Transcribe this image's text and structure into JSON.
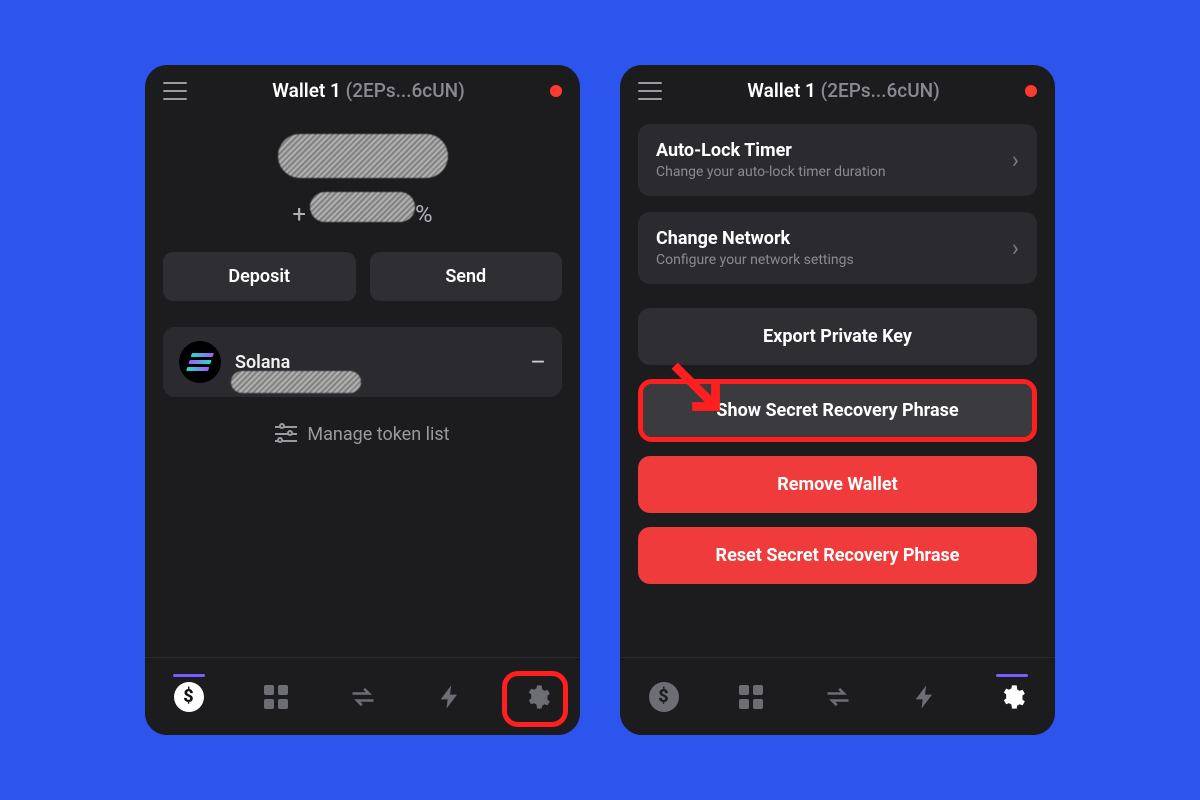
{
  "header": {
    "wallet_name": "Wallet 1",
    "short_address": "(2EPs...6cUN)"
  },
  "left": {
    "balance_hidden": true,
    "pct_prefix": "+",
    "pct_suffix": "%",
    "deposit_label": "Deposit",
    "send_label": "Send",
    "token": {
      "name": "Solana",
      "amount_indicator": "–"
    },
    "manage_label": "Manage token list"
  },
  "right": {
    "rows": [
      {
        "title": "Auto-Lock Timer",
        "subtitle": "Change your auto-lock timer duration"
      },
      {
        "title": "Change Network",
        "subtitle": "Configure your network settings"
      }
    ],
    "buttons": {
      "export": "Export Private Key",
      "show_phrase": "Show Secret Recovery Phrase",
      "remove": "Remove Wallet",
      "reset": "Reset Secret Recovery Phrase"
    }
  },
  "tabs": {
    "dollar": "$",
    "labels": [
      "wallet",
      "collectibles",
      "swap",
      "activity",
      "settings"
    ]
  },
  "colors": {
    "bg": "#2b55ed",
    "panel": "#1c1c1e",
    "danger": "#ef3b3b",
    "highlight": "#ff1f1f",
    "accent": "#7a5cff"
  }
}
